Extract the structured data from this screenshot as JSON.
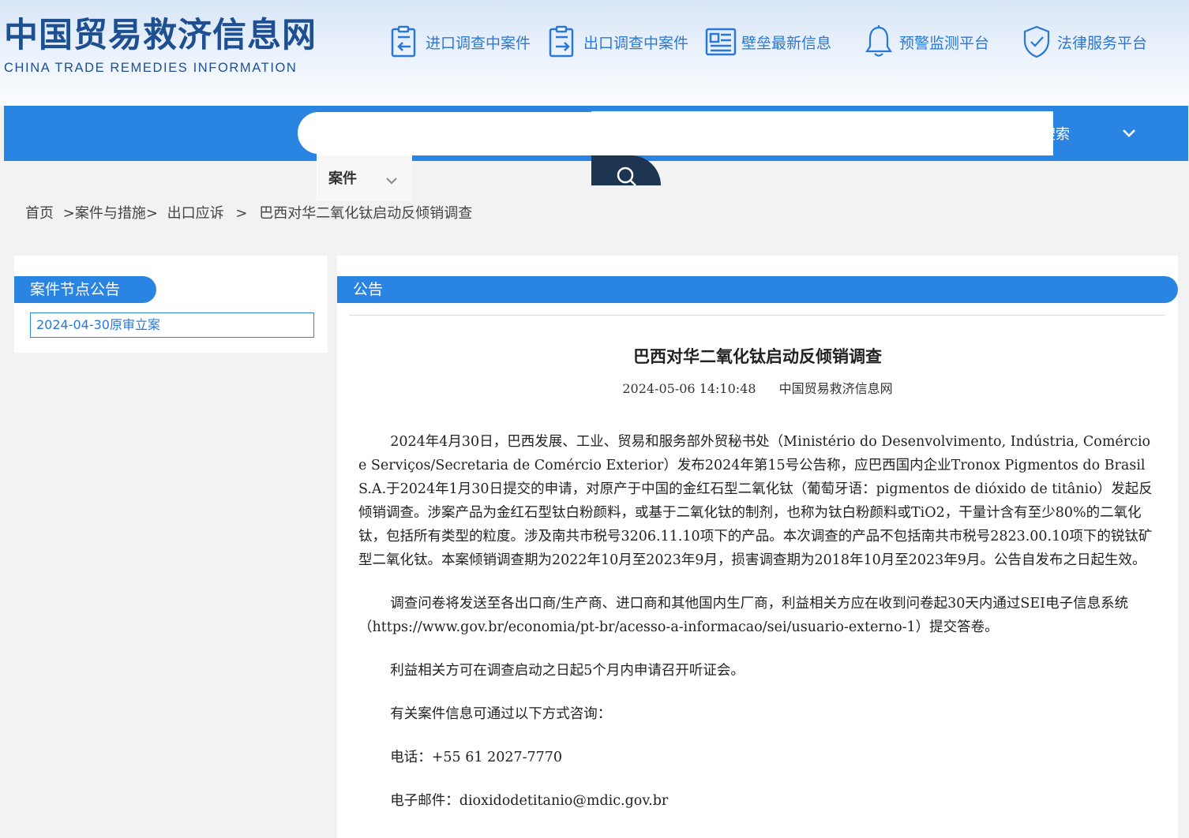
{
  "logo": {
    "cn": "中国贸易救济信息网",
    "en": "CHINA TRADE REMEDIES INFORMATION"
  },
  "topnav": [
    {
      "label": "进口调查中案件",
      "icon": "import-document-icon"
    },
    {
      "label": "出口调查中案件",
      "icon": "export-document-icon"
    },
    {
      "label": "壁垒最新信息",
      "icon": "news-icon"
    },
    {
      "label": "预警监测平台",
      "icon": "bell-icon"
    },
    {
      "label": "法律服务平台",
      "icon": "shield-check-icon"
    }
  ],
  "search": {
    "category": "案件",
    "input_value": "",
    "label": "搜索"
  },
  "breadcrumb": {
    "home": "首页",
    "level1": ">案件与措施>",
    "level2": "出口应诉",
    "sep": ">",
    "current": "巴西对华二氧化钛启动反倾销调查"
  },
  "sidebar": {
    "title": "案件节点公告",
    "items": [
      {
        "label": "2024-04-30原审立案"
      }
    ]
  },
  "main": {
    "section_title": "公告",
    "article": {
      "title": "巴西对华二氧化钛启动反倾销调查",
      "date": "2024-05-06 14:10:48",
      "source": "中国贸易救济信息网",
      "paragraphs": [
        "2024年4月30日，巴西发展、工业、贸易和服务部外贸秘书处（Ministério do Desenvolvimento, Indústria, Comércio e Serviços/Secretaria de Comércio Exterior）发布2024年第15号公告称，应巴西国内企业Tronox Pigmentos do Brasil S.A.于2024年1月30日提交的申请，对原产于中国的金红石型二氧化钛（葡萄牙语：pigmentos de dióxido de titânio）发起反倾销调查。涉案产品为金红石型钛白粉颜料，或基于二氧化钛的制剂，也称为钛白粉颜料或TiO2，干量计含有至少80%的二氧化钛，包括所有类型的粒度。涉及南共市税号3206.11.10项下的产品。本次调查的产品不包括南共市税号2823.00.10项下的锐钛矿型二氧化钛。本案倾销调查期为2022年10月至2023年9月，损害调查期为2018年10月至2023年9月。公告自发布之日起生效。",
        "调查问卷将发送至各出口商/生产商、进口商和其他国内生厂商，利益相关方应在收到问卷起30天内通过SEI电子信息系统（https://www.gov.br/economia/pt-br/acesso-a-informacao/sei/usuario-externo-1）提交答卷。",
        "利益相关方可在调查启动之日起5个月内申请召开听证会。",
        "有关案件信息可通过以下方式咨询：",
        "电话：+55 61 2027-7770",
        "电子邮件：dioxidodetitanio@mdic.gov.br"
      ]
    }
  },
  "colors": {
    "primary_blue": "#2a84e2",
    "link_blue": "#2a78d6",
    "logo_blue": "#1d4f91",
    "search_button": "#1e3552"
  }
}
